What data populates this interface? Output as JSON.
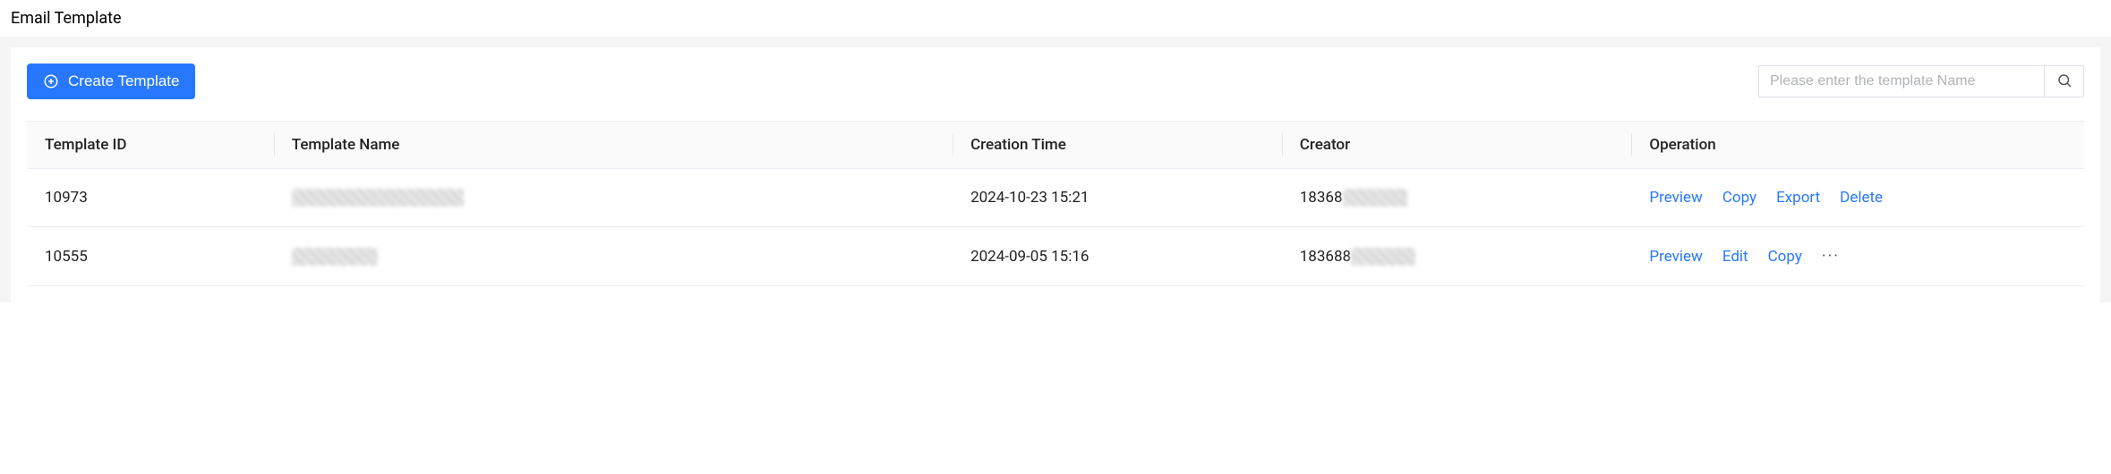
{
  "page": {
    "title": "Email Template"
  },
  "toolbar": {
    "create_label": "Create Template",
    "search_placeholder": "Please enter the template Name"
  },
  "table": {
    "headers": {
      "id": "Template ID",
      "name": "Template Name",
      "time": "Creation Time",
      "creator": "Creator",
      "op": "Operation"
    },
    "rows": [
      {
        "id": "10973",
        "name": "████████████████",
        "time": "2024-10-23 15:21",
        "creator_prefix": "18368",
        "creator_suffix": "██████",
        "ops": [
          "Preview",
          "Copy",
          "Export",
          "Delete"
        ]
      },
      {
        "id": "10555",
        "name": "████████",
        "time": "2024-09-05 15:16",
        "creator_prefix": "183688",
        "creator_suffix": "██████",
        "ops": [
          "Preview",
          "Edit",
          "Copy"
        ],
        "more": true
      }
    ]
  }
}
